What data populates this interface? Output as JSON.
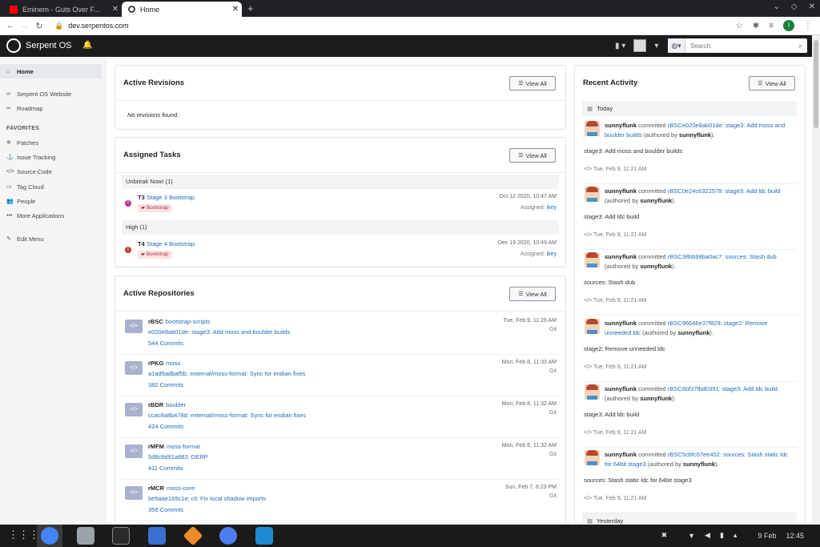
{
  "browser": {
    "tabs": [
      {
        "title": "Eminem - Guts Over F..."
      },
      {
        "title": "Home"
      }
    ],
    "url": "dev.serpentos.com"
  },
  "app": {
    "name": "Serpent OS",
    "search_placeholder": "Search"
  },
  "sidebar": {
    "items": [
      {
        "label": "Home"
      },
      {
        "label": "Serpent OS Website"
      },
      {
        "label": "Roadmap"
      }
    ],
    "favorites_heading": "FAVORITES",
    "favorites": [
      {
        "label": "Patches"
      },
      {
        "label": "Issue Tracking"
      },
      {
        "label": "Source Code"
      },
      {
        "label": "Tag Cloud"
      },
      {
        "label": "People"
      },
      {
        "label": "More Applications"
      }
    ],
    "edit_menu": "Edit Menu"
  },
  "common": {
    "view_all": "View All"
  },
  "active_revisions": {
    "title": "Active Revisions",
    "empty": "No revisions found."
  },
  "assigned_tasks": {
    "title": "Assigned Tasks",
    "groups": [
      {
        "heading": "Unbreak Now! (1)",
        "task": {
          "id": "T3",
          "name": "Stage 3 Bootstrap",
          "tag": "Bootstrap",
          "date": "Oct 12 2020, 10:47 AM",
          "assigned_label": "Assigned:",
          "assignee": "ikey",
          "priority_color": "#c2298f"
        }
      },
      {
        "heading": "High (1)",
        "task": {
          "id": "T4",
          "name": "Stage 4 Bootstrap",
          "tag": "Bootstrap",
          "date": "Dec 19 2020, 10:49 AM",
          "assigned_label": "Assigned:",
          "assignee": "ikey",
          "priority_color": "#c0392b"
        }
      }
    ]
  },
  "active_repositories": {
    "title": "Active Repositories",
    "repos": [
      {
        "callsign": "rBSC",
        "name": "bootstrap-scripts",
        "commit": "e020e8ab01de: stage3: Add moss and boulder builds",
        "commits": "544 Commits",
        "date": "Tue, Feb 9, 11:26 AM",
        "vcs": "Git"
      },
      {
        "callsign": "rPKG",
        "name": "moss",
        "commit": "a1ad5adbaf5b: external/moss-format: Sync for endian fixes",
        "commits": "382 Commits",
        "date": "Mon, Feb 8, 11:33 AM",
        "vcs": "Git"
      },
      {
        "callsign": "rBDR",
        "name": "boulder",
        "commit": "ccac8a8b478d: external/moss-format: Sync for endian fixes",
        "commits": "424 Commits",
        "date": "Mon, Feb 8, 11:32 AM",
        "vcs": "Git"
      },
      {
        "callsign": "rMFM",
        "name": "moss-format",
        "commit": "5d8c8d91a882: DERP",
        "commits": "411 Commits",
        "date": "Mon, Feb 8, 11:32 AM",
        "vcs": "Git"
      },
      {
        "callsign": "rMCR",
        "name": "moss-core",
        "commit": "be5aae165c1e: cli: Fix local shadow imports",
        "commits": "358 Commits",
        "date": "Sun, Feb 7, 8:23 PM",
        "vcs": "Git"
      }
    ]
  },
  "recent_activity": {
    "title": "Recent Activity",
    "today": "Today",
    "yesterday": "Yesterday",
    "stories": [
      {
        "user": "sunnyflunk",
        "verb": "committed",
        "link": "rBSCe020e8ab01de: stage3: Add moss and boulder builds",
        "authored": "(authored by",
        "author": "sunnyflunk",
        "close": ").",
        "body": "stage3: Add moss and boulder builds",
        "time": "Tue, Feb 9, 11:21 AM"
      },
      {
        "user": "sunnyflunk",
        "verb": "committed",
        "link": "rBSC0e24c6322578: stage3: Add ldc build",
        "authored": "(authored by",
        "author": "sunnyflunk",
        "close": ").",
        "body": "stage3: Add ldc build",
        "time": "Tue, Feb 9, 11:21 AM"
      },
      {
        "user": "sunnyflunk",
        "verb": "committed",
        "link": "rBSC38bb98ba0ac7: sources: Stash dub",
        "authored": "(authored by",
        "author": "sunnyflunk",
        "close": ").",
        "body": "sources: Stash dub",
        "time": "Tue, Feb 9, 11:21 AM"
      },
      {
        "user": "sunnyflunk",
        "verb": "committed",
        "link": "rBSC96646e37f829: stage2: Remove unneeded ldc",
        "authored": "(authored by",
        "author": "sunnyflunk",
        "close": ").",
        "body": "stage2: Remove unneeded ldc",
        "time": "Tue, Feb 9, 11:21 AM"
      },
      {
        "user": "sunnyflunk",
        "verb": "committed",
        "link": "rBSC6bf37fbd0391: stage3: Add ldc build",
        "authored": "(authored by",
        "author": "sunnyflunk",
        "close": ").",
        "body": "stage3: Add ldc build",
        "time": "Tue, Feb 9, 11:21 AM"
      },
      {
        "user": "sunnyflunk",
        "verb": "committed",
        "link": "rBSC5cbfc07ee452: sources: Stash static ldc for 64bit stage3",
        "authored": "(authored by",
        "author": "sunnyflunk",
        "close": ").",
        "body": "sources: Stash static ldc for 64bit stage3",
        "time": "Tue, Feb 9, 11:21 AM"
      }
    ]
  },
  "taskbar": {
    "date": "9 Feb",
    "time": "12:45",
    "apps": [
      {
        "icon": "chrome-icon",
        "color": "#4285f4"
      },
      {
        "icon": "files-icon",
        "color": "#9aa3a8"
      },
      {
        "icon": "terminal-icon",
        "color": "#2b2b2b"
      },
      {
        "icon": "tasks-icon",
        "color": "#3b6fd0"
      },
      {
        "icon": "hexchat-icon",
        "color": "#f08a24"
      },
      {
        "icon": "signal-icon",
        "color": "#4a7ef0"
      },
      {
        "icon": "vscode-icon",
        "color": "#1f8ad2"
      }
    ]
  },
  "profile_initial": "I"
}
